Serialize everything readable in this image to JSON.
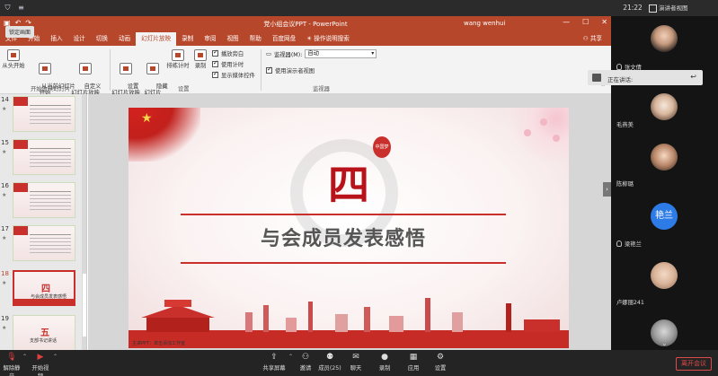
{
  "meeting": {
    "lock_badge": "锁定画面",
    "clock": "21:22",
    "view_mode": "演讲者视图",
    "speaking_label": "正在讲话:",
    "leave_button": "离开会议"
  },
  "ppt": {
    "doc_title": "党小组会议PPT  -  PowerPoint",
    "user_name": "wang wenhui",
    "tabs": [
      "文件",
      "开始",
      "插入",
      "设计",
      "切换",
      "动画",
      "幻灯片放映",
      "录制",
      "审阅",
      "视图",
      "帮助",
      "百度网盘",
      "操作说明搜索"
    ],
    "share": "共享",
    "ribbon": {
      "from_start": "从头开始",
      "from_current": "从当前幻灯片\n开始",
      "custom_show": "自定义\n幻灯片放映",
      "group_start": "开始放映幻灯片",
      "setup_show": "设置\n幻灯片放映",
      "hide_slide": "隐藏\n幻灯片",
      "rehearse": "排练计时",
      "record": "录制",
      "play_narration": "播放旁白",
      "use_timings": "使用计时",
      "show_media": "显示媒体控件",
      "group_setup": "设置",
      "monitor_label": "监视器(M):",
      "monitor_value": "自动",
      "presenter_view": "使用演示者视图",
      "group_monitor": "监视器"
    },
    "thumbnails": [
      {
        "num": "14"
      },
      {
        "num": "15"
      },
      {
        "num": "16"
      },
      {
        "num": "17"
      },
      {
        "num": "18",
        "big": "四",
        "small": "与会成员发表感悟"
      },
      {
        "num": "19",
        "big": "五",
        "small": "支部书记讲话"
      }
    ],
    "slide": {
      "big_char": "四",
      "title": "与会成员发表感悟",
      "seal": "中国梦",
      "footnote": "主讲PPT：单击添加工作室"
    }
  },
  "participants": [
    {
      "name": "张文倩"
    },
    {
      "name": "毛燕美"
    },
    {
      "name": "陈柳璐"
    },
    {
      "name": "梁艳兰",
      "initials": "艳兰"
    },
    {
      "name": "卢娜丽241"
    },
    {
      "name": ""
    }
  ],
  "toolbar": {
    "mute": "解除静音",
    "video": "开始视频",
    "share": "共享屏幕",
    "invite": "邀请",
    "members": "成员(25)",
    "chat": "聊天",
    "record": "录制",
    "apps": "应用",
    "settings": "设置"
  }
}
